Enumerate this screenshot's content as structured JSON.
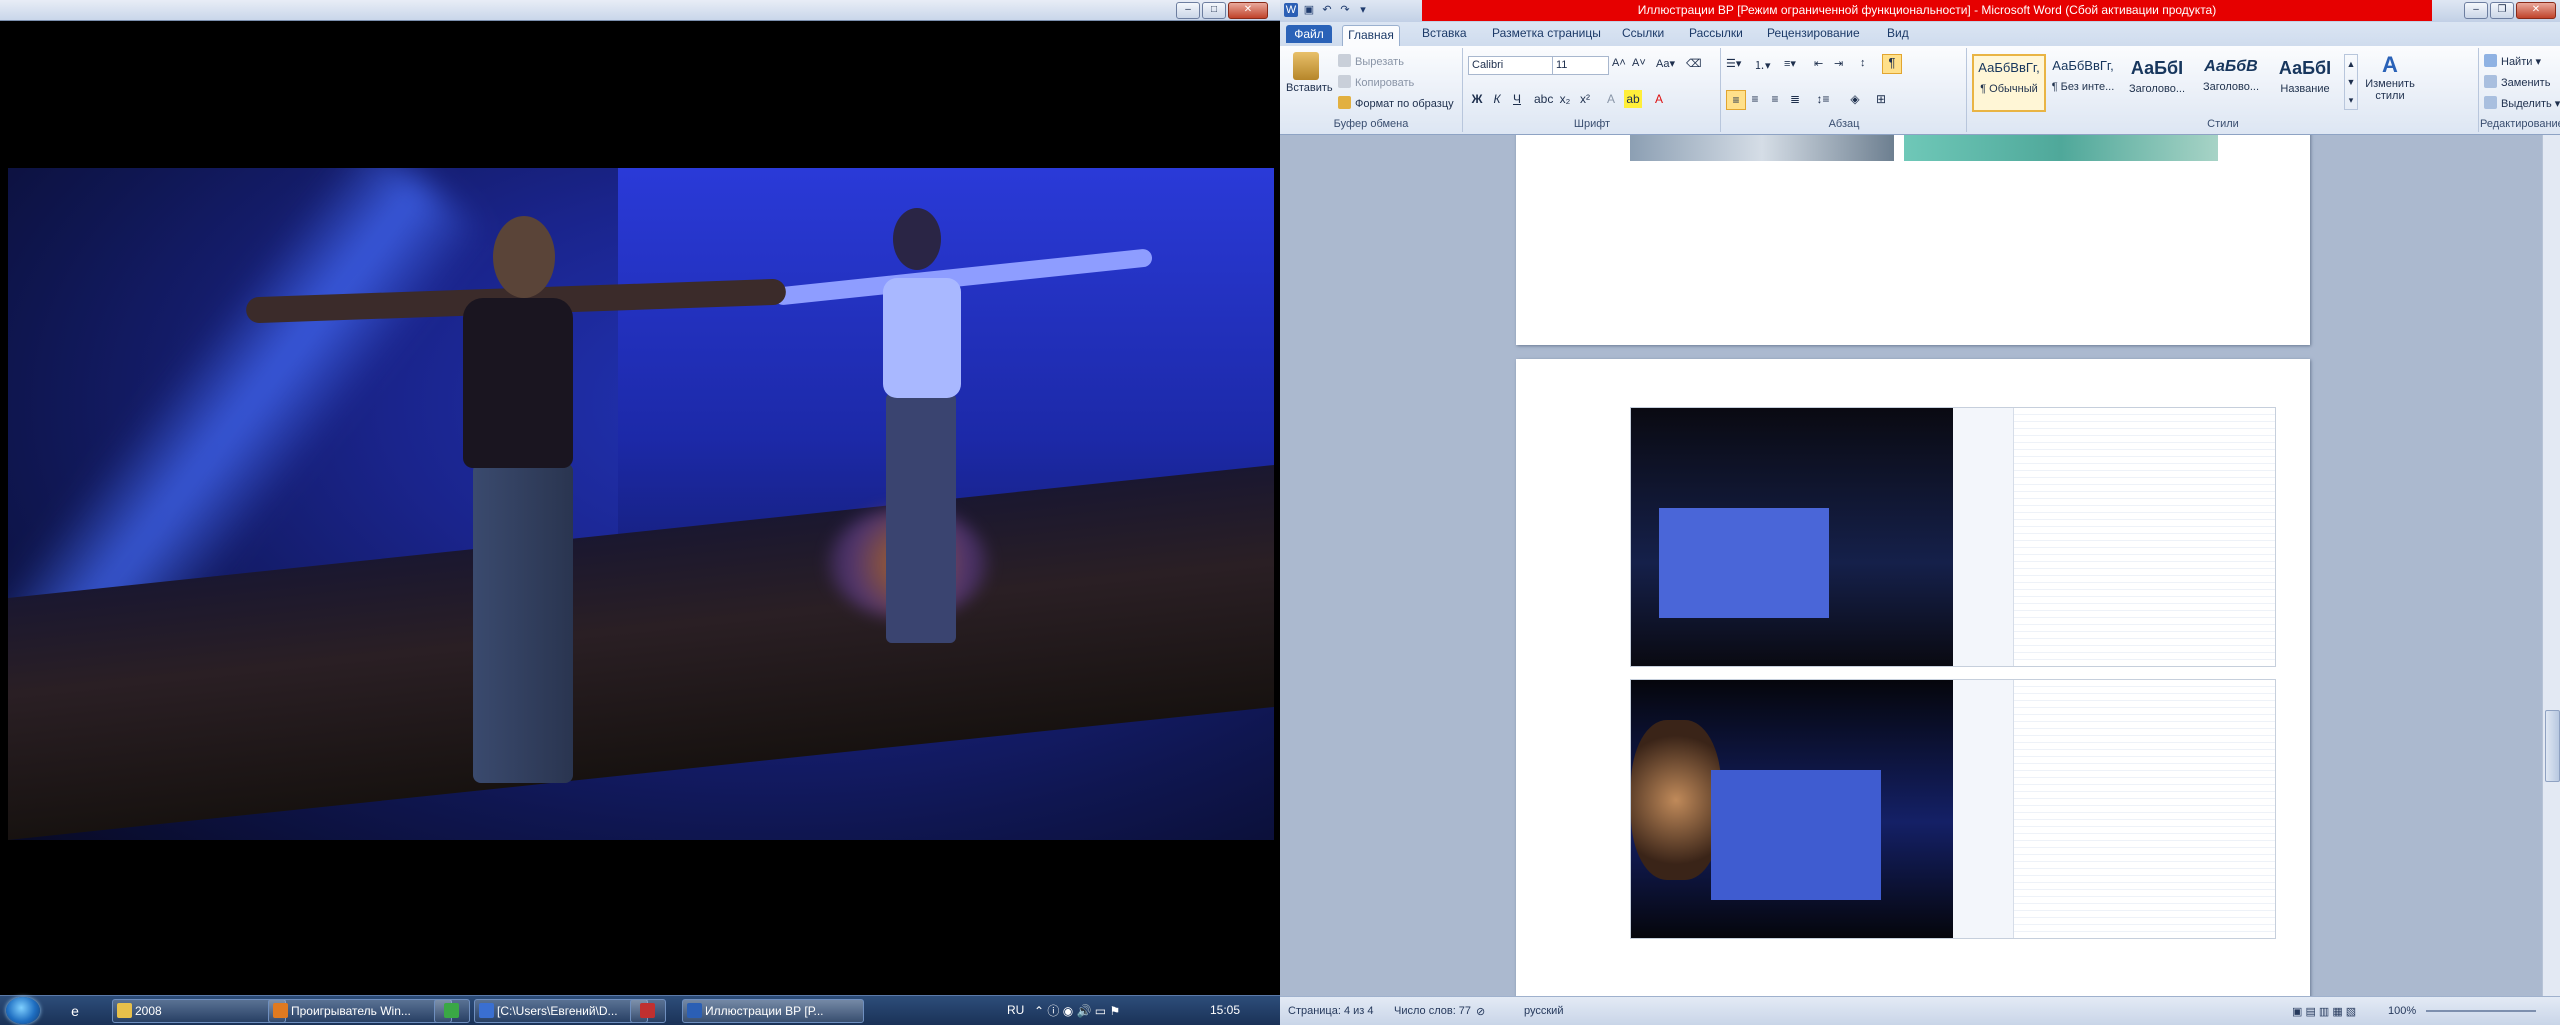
{
  "word": {
    "title": "Иллюстрации ВР [Режим ограниченной функциональности] - Microsoft Word (Сбой активации продукта)",
    "tabs": [
      "Файл",
      "Главная",
      "Вставка",
      "Разметка страницы",
      "Ссылки",
      "Рассылки",
      "Рецензирование",
      "Вид"
    ],
    "clipboard": {
      "paste": "Вставить",
      "cut": "Вырезать",
      "copy": "Копировать",
      "format_painter": "Формат по образцу",
      "group": "Буфер обмена"
    },
    "font": {
      "name": "Calibri",
      "size": "11",
      "group": "Шрифт",
      "bold": "Ж",
      "italic": "К",
      "underline": "Ч"
    },
    "paragraph": {
      "group": "Абзац"
    },
    "styles": {
      "group": "Стили",
      "items": [
        {
          "sample": "АаБбВвГг,",
          "name": "¶ Обычный"
        },
        {
          "sample": "АаБбВвГг,",
          "name": "¶ Без инте..."
        },
        {
          "sample": "АаБбI",
          "name": "Заголово..."
        },
        {
          "sample": "АаБбВ",
          "name": "Заголово..."
        },
        {
          "sample": "АаБбI",
          "name": "Название"
        }
      ],
      "change": "Изменить стили"
    },
    "editing": {
      "group": "Редактирование",
      "find": "Найти",
      "replace": "Заменить",
      "select": "Выделить"
    },
    "status": {
      "page": "Страница: 4 из 4",
      "words": "Число слов: 77",
      "language": "русский",
      "zoom": "100%"
    }
  },
  "taskbar": {
    "items": [
      {
        "label": "2008",
        "color": "#e8c04a"
      },
      {
        "label": "Проигрыватель Win...",
        "color": "#e07a20"
      },
      {
        "label": "",
        "color": "#3aa845"
      },
      {
        "label": "[C:\\Users\\Евгений\\D...",
        "color": "#3a6fd1"
      },
      {
        "label": "",
        "color": "#c03030"
      },
      {
        "label": "Иллюстрации ВР [Р...",
        "color": "#2b5fb5"
      }
    ],
    "lang": "RU",
    "time": "15:05"
  }
}
